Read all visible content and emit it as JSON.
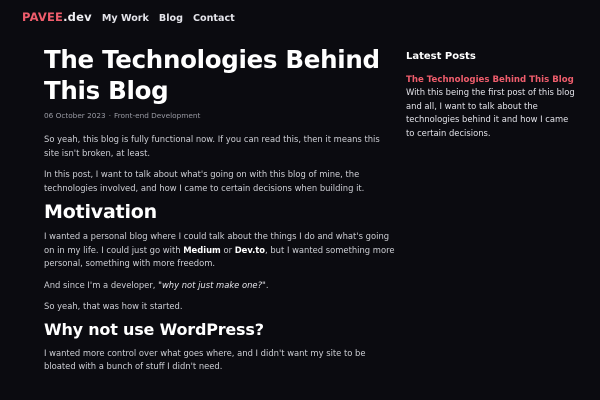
{
  "header": {
    "brand_main": "PAVEE",
    "brand_tld": ".dev",
    "nav": [
      {
        "label": "My Work"
      },
      {
        "label": "Blog"
      },
      {
        "label": "Contact"
      }
    ]
  },
  "post": {
    "title_line1": "The Technologies Behind",
    "title_line2": "This Blog",
    "date": "06 October 2023",
    "separator": "·",
    "category": "Front-end Development",
    "intro_p1": "So yeah, this blog is fully functional now. If you can read this, then it means this site isn't broken, at least.",
    "intro_p2": "In this post, I want to talk about what's going on with this blog of mine, the technologies involved, and how I came to certain decisions when building it.",
    "motivation_heading": "Motivation",
    "motivation_p1_a": "I wanted a personal blog where I could talk about the things I do and what's going on in my life. I could just go with ",
    "motivation_p1_medium": "Medium",
    "motivation_p1_or": " or ",
    "motivation_p1_devto": "Dev.to",
    "motivation_p1_b": ", but I wanted something more personal, something with more freedom.",
    "motivation_p2_a": "And since I'm a developer, ",
    "motivation_p2_quote": "\"why not just make one?\"",
    "motivation_p2_b": ".",
    "motivation_p3": "So yeah, that was how it started.",
    "wordpress_heading": "Why not use WordPress?",
    "wordpress_p1": "I wanted more control over what goes where, and I didn't want my site to be bloated with a bunch of stuff I didn't need."
  },
  "sidebar": {
    "heading": "Latest Posts",
    "latest": [
      {
        "title": "The Technologies Behind This Blog",
        "excerpt": "With this being the first post of this blog and all, I want to talk about the technologies behind it and how I came to certain decisions."
      }
    ]
  },
  "colors": {
    "background": "#0b0b10",
    "accent": "#ef5d6c",
    "heading": "#ffffff",
    "body_text": "#cfd0d6"
  }
}
